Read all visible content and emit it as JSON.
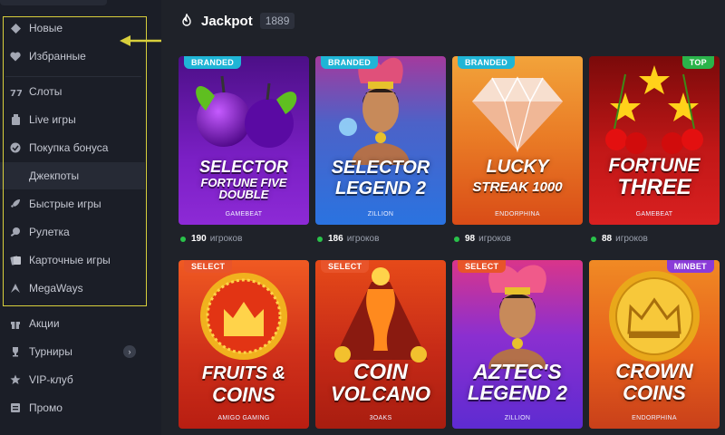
{
  "sidebar": {
    "items": [
      {
        "label": "Новые",
        "icon": "diamond-icon"
      },
      {
        "label": "Избранные",
        "icon": "heart-icon"
      },
      {
        "label": "Слоты",
        "icon": "slots-icon"
      },
      {
        "label": "Live игры",
        "icon": "live-icon"
      },
      {
        "label": "Покупка бонуса",
        "icon": "bonus-icon"
      },
      {
        "label": "Джекпоты",
        "icon": ""
      },
      {
        "label": "Быстрые игры",
        "icon": "rocket-icon"
      },
      {
        "label": "Рулетка",
        "icon": "roulette-icon"
      },
      {
        "label": "Карточные игры",
        "icon": "cards-icon"
      },
      {
        "label": "MegaWays",
        "icon": "megaways-icon"
      },
      {
        "label": "Акции",
        "icon": "gift-icon"
      },
      {
        "label": "Турниры",
        "icon": "trophy-icon"
      },
      {
        "label": "VIP-клуб",
        "icon": "star-icon"
      },
      {
        "label": "Промо",
        "icon": "promo-icon"
      }
    ],
    "highlight_color": "#d8cf3c",
    "active_item": "Джекпоты"
  },
  "main": {
    "title": "Jackpot",
    "count": "1889",
    "players_suffix": "игроков",
    "games": [
      {
        "badge": "BRANDED",
        "badge_color": "#1fb5d6",
        "title_l1": "SELECTOR",
        "title_l2": "FORTUNE FIVE",
        "title_l3": "DOUBLE",
        "provider": "GAMEBEAT",
        "players": "190",
        "bg": "#7a1fc4"
      },
      {
        "badge": "BRANDED",
        "badge_color": "#1fb5d6",
        "title_l1": "SELECTOR",
        "title_l2": "LEGEND 2",
        "title_l3": "",
        "provider": "ZILLION",
        "players": "186",
        "bg": "#2a73e0"
      },
      {
        "badge": "BRANDED",
        "badge_color": "#1fb5d6",
        "title_l1": "LUCKY",
        "title_l2": "STREAK 1000",
        "title_l3": "",
        "provider": "ENDORPHINA",
        "players": "98",
        "bg": "#e3561a"
      },
      {
        "badge": "TOP",
        "badge_color": "#2ab34a",
        "title_l1": "FORTUNE",
        "title_l2": "THREE",
        "title_l3": "",
        "provider": "GAMEBEAT",
        "players": "88",
        "bg": "#d61e1e"
      },
      {
        "badge": "SELECT",
        "badge_color": "#e8542a",
        "title_l1": "FRUITS &",
        "title_l2": "COINS",
        "title_l3": "",
        "provider": "AMIGO GAMING",
        "players": "",
        "bg": "#d0311a"
      },
      {
        "badge": "SELECT",
        "badge_color": "#e8542a",
        "title_l1": "COIN",
        "title_l2": "VOLCANO",
        "title_l3": "",
        "provider": "3OAKS",
        "players": "",
        "bg": "#c62a17"
      },
      {
        "badge": "SELECT",
        "badge_color": "#e8542a",
        "title_l1": "AZTEC'S",
        "title_l2": "LEGEND 2",
        "title_l3": "",
        "provider": "ZILLION",
        "players": "",
        "bg": "#5e2bd1"
      },
      {
        "badge": "MINBET",
        "badge_color": "#8a3bd8",
        "title_l1": "CROWN",
        "title_l2": "COINS",
        "title_l3": "",
        "provider": "ENDORPHINA",
        "players": "",
        "bg": "#e7601c"
      }
    ]
  }
}
